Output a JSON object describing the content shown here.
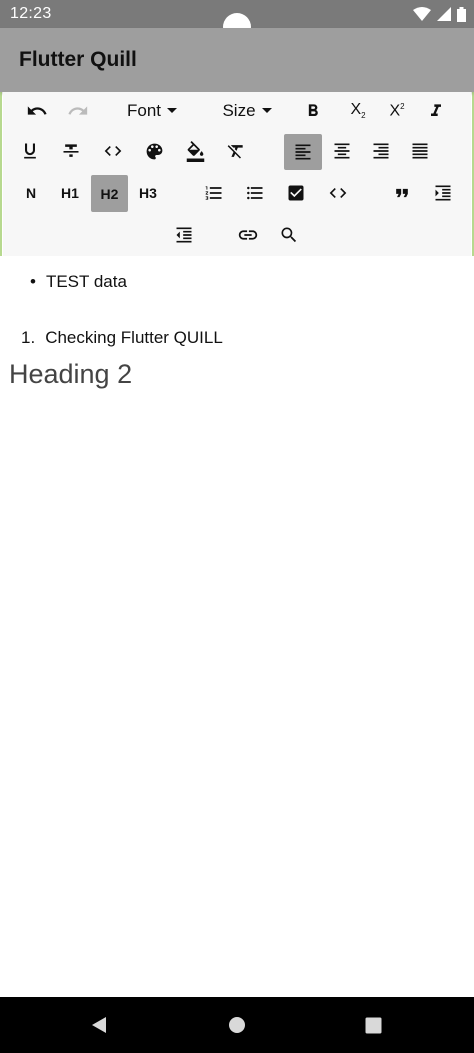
{
  "status_bar": {
    "time": "12:23"
  },
  "app_bar": {
    "title": "Flutter Quill"
  },
  "toolbar": {
    "font_label": "Font",
    "size_label": "Size",
    "subscript_label": "X",
    "subscript_mark": "2",
    "superscript_label": "X",
    "superscript_mark": "2",
    "heading_buttons": [
      "N",
      "H1",
      "H2",
      "H3"
    ],
    "active_heading": "H2",
    "active_alignment": "left"
  },
  "editor": {
    "bullet_marker": "•",
    "bullet_text": "TEST data",
    "ordered_marker": "1.",
    "ordered_text": "Checking Flutter QUILL",
    "heading_text": "Heading 2"
  },
  "colors": {
    "status_bar": "#7a7a7a",
    "app_bar": "#9e9e9e",
    "toolbar_bg": "#f7f7f7",
    "selected_button": "#9e9e9e",
    "frame_border": "#b7d98f"
  }
}
